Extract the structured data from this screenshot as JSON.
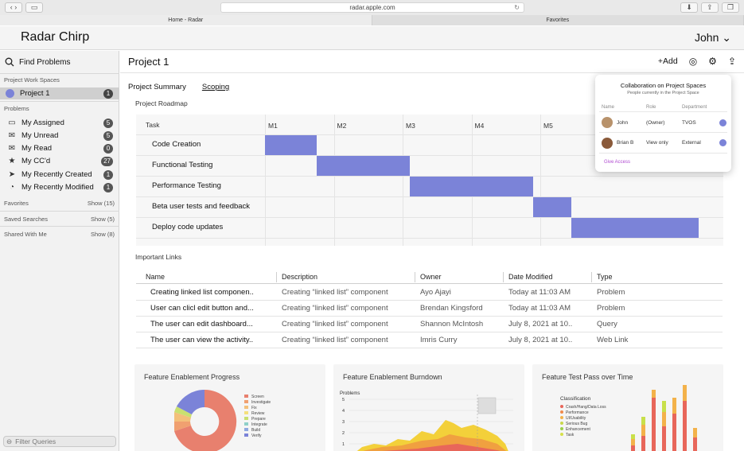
{
  "browser": {
    "url": "radar.apple.com",
    "tabs": [
      "Home - Radar",
      "Favorites"
    ]
  },
  "app": {
    "title": "Radar Chirp",
    "user": "John"
  },
  "sidebar": {
    "search_label": "Find Problems",
    "workspaces_heading": "Project Work Spaces",
    "project": {
      "label": "Project 1",
      "count": "1"
    },
    "problems_heading": "Problems",
    "items": [
      {
        "label": "My Assigned",
        "count": "5",
        "icon": "tray-icon"
      },
      {
        "label": "My Unread",
        "count": "5",
        "icon": "envelope-icon"
      },
      {
        "label": "My Read",
        "count": "0",
        "icon": "open-envelope-icon"
      },
      {
        "label": "My CC'd",
        "count": "27",
        "icon": "star-icon"
      },
      {
        "label": "My Recently Created",
        "count": "1",
        "icon": "send-icon"
      },
      {
        "label": "My Recently Modified",
        "count": "1",
        "icon": "clock-icon"
      }
    ],
    "favorites": {
      "label": "Favorites",
      "action": "Show (15)"
    },
    "saved_searches": {
      "label": "Saved Searches",
      "action": "Show (5)"
    },
    "shared": {
      "label": "Shared With Me",
      "action": "Show (8)"
    },
    "filter_placeholder": "Filter Queries"
  },
  "main": {
    "title": "Project 1",
    "add_label": "Add",
    "tabs": [
      "Project Summary",
      "Scoping"
    ],
    "roadmap": {
      "heading": "Project Roadmap",
      "task_header": "Task",
      "months": [
        "M1",
        "M2",
        "M3",
        "M4",
        "M5"
      ],
      "tasks": [
        {
          "name": "Code Creation",
          "start": 0.0,
          "end": 0.75
        },
        {
          "name": "Functional Testing",
          "start": 0.75,
          "end": 2.1
        },
        {
          "name": "Performance Testing",
          "start": 2.1,
          "end": 3.9
        },
        {
          "name": "Beta user tests and feedback",
          "start": 3.9,
          "end": 4.45
        },
        {
          "name": "Deploy code updates",
          "start": 4.45,
          "end": 6.3
        }
      ]
    },
    "links": {
      "heading": "Important Links",
      "columns": [
        "Name",
        "Description",
        "Owner",
        "Date Modified",
        "Type"
      ],
      "rows": [
        [
          "Creating linked list componen..",
          "Creating “linked list” component",
          "Ayo Ajayi",
          "Today at 11:03 AM",
          "Problem"
        ],
        [
          "User can clicl edit button and...",
          "Creating “linked list” component",
          "Brendan Kingsford",
          "Today at 11:03 AM",
          "Problem"
        ],
        [
          "The user can edit dashboard...",
          "Creating “linked list” component",
          "Shannon McIntosh",
          "July 8, 2021 at 10..",
          "Query"
        ],
        [
          "The user can view the activity..",
          "Creating “linked list” component",
          "Imris Curry",
          "July 8, 2021 at 10..",
          "Web Link"
        ]
      ]
    },
    "cards": {
      "progress": {
        "title": "Feature Enablement Progress",
        "legend": [
          "Screen",
          "Investigate",
          "Fix",
          "Review",
          "Prepare",
          "Integrate",
          "Build",
          "Verify"
        ],
        "colors": [
          "#e8806e",
          "#f0a070",
          "#f3c07a",
          "#f5e07c",
          "#c9e070",
          "#8fd0c8",
          "#8fa8e0",
          "#7b83d8"
        ]
      },
      "burndown": {
        "title": "Feature Enablement Burndown",
        "ylabel": "Problems",
        "yticks": [
          "5",
          "4",
          "3",
          "2",
          "1"
        ]
      },
      "testpass": {
        "title": "Feature Test Pass over Time",
        "legend_title": "Classification",
        "legend": [
          "Crash/Hang/Data Loss",
          "Performance",
          "UI/Usability",
          "Serious Bug",
          "Enhancement",
          "Task"
        ],
        "colors": [
          "#e8665a",
          "#f08a4a",
          "#f3b24a",
          "#c8d84a",
          "#9ad04a",
          "#d6e04a"
        ]
      }
    }
  },
  "popover": {
    "title": "Collaboration on Project Spaces",
    "subtitle": "People currently in the Project Space",
    "headers": [
      "Name",
      "Role",
      "Department"
    ],
    "people": [
      {
        "name": "John",
        "role": "(Owner)",
        "dept": "TVOS"
      },
      {
        "name": "Brian B",
        "role": "View only",
        "dept": "External"
      }
    ],
    "give_access": "Give Access"
  }
}
